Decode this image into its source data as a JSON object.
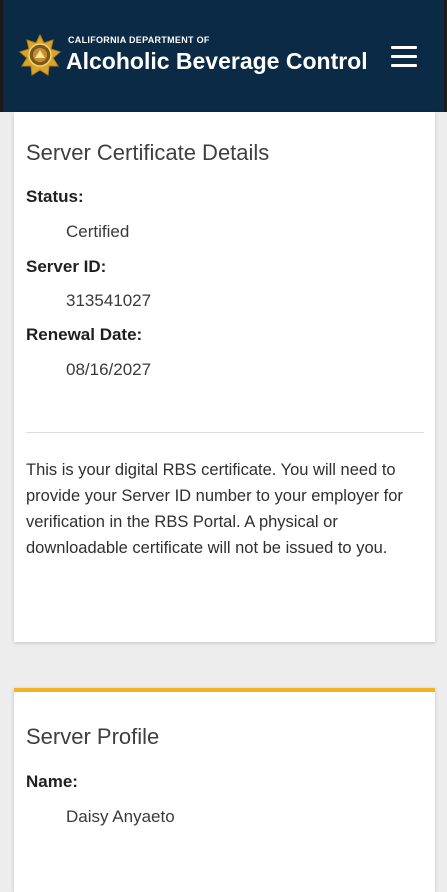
{
  "header": {
    "org_small": "CALIFORNIA DEPARTMENT OF",
    "org_large": "Alcoholic Beverage Control",
    "menu_icon": "hamburger-menu-icon",
    "seal_icon": "state-seal-icon",
    "background_color": "#0b2a45"
  },
  "details_card": {
    "title": "Server Certificate Details",
    "fields": [
      {
        "label": "Status:",
        "value": "Certified"
      },
      {
        "label": "Server ID:",
        "value": "313541027"
      },
      {
        "label": "Renewal Date:",
        "value": "08/16/2027"
      }
    ],
    "note": "This is your digital RBS certificate. You will need to provide your Server ID number to your employer for verification in the RBS Portal. A physical or downloadable certificate will not be issued to you."
  },
  "profile_card": {
    "title": "Server Profile",
    "accent_color": "#f5b324",
    "fields": [
      {
        "label": "Name:",
        "value": "Daisy Anyaeto"
      }
    ]
  }
}
